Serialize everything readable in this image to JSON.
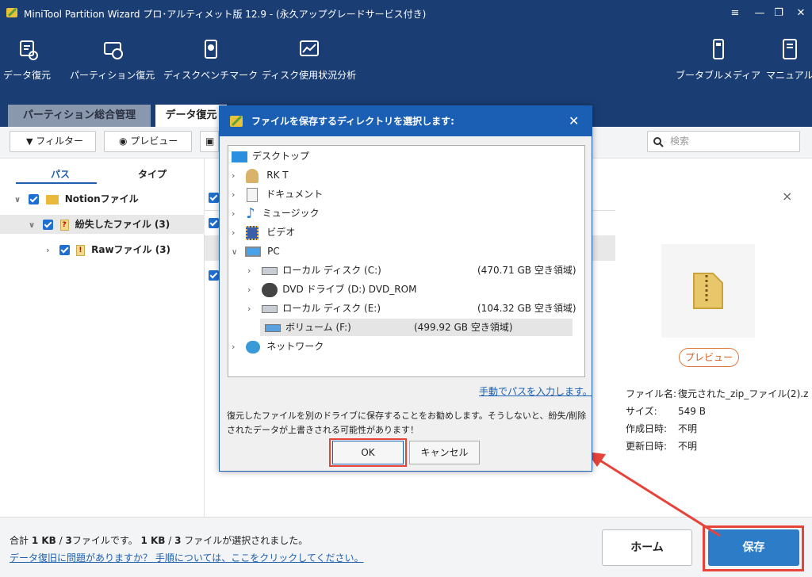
{
  "window": {
    "title": "MiniTool Partition Wizard プロ･アルティメット版 12.9 - (永久アップグレードサービス付き)",
    "controls": [
      "≡",
      "—",
      "❐",
      "✕"
    ]
  },
  "toolbar_main": {
    "items": [
      "データ復元",
      "パーティション復元",
      "ディスクベンチマーク",
      "ディスク使用状況分析"
    ],
    "right_items": [
      "ブータブルメディア",
      "マニュアル"
    ]
  },
  "tabs": [
    "パーティション総合管理",
    "データ復元"
  ],
  "action_bar": {
    "filter": "フィルター",
    "preview": "プレビュー",
    "search_placeholder": "検索"
  },
  "left_pane": {
    "subtabs": [
      "パス",
      "タイプ"
    ],
    "tree": [
      "Notionファイル",
      "紛失したファイル (3)",
      "Rawファイル (3)"
    ]
  },
  "right_pane": {
    "close": "×",
    "preview_button": "プレビュー",
    "info_labels": [
      "ファイル名:",
      "サイズ:",
      "作成日時:",
      "更新日時:"
    ],
    "info_values": [
      "復元された_zip_ファイル(2).z",
      "549 B",
      "不明",
      "不明"
    ]
  },
  "bottom": {
    "summary_prefix": "合計 ",
    "summary_b1": "1 KB",
    "summary_mid": " / ",
    "summary_b2": "3",
    "summary_mid2": "ファイルです。 ",
    "summary_b3": "1 KB",
    "summary_mid3": " / ",
    "summary_b4": "3",
    "summary_end": " ファイルが選択されました。",
    "help_link": "データ復旧に問題がありますか？ 手順については、ここをクリックしてください。",
    "home_button": "ホーム",
    "save_button": "保存"
  },
  "dialog": {
    "title": "ファイルを保存するディレクトリを選択します:",
    "close": "✕",
    "tree": [
      {
        "label": "デスクトップ",
        "size": ""
      },
      {
        "label": "RK T",
        "size": ""
      },
      {
        "label": "ドキュメント",
        "size": ""
      },
      {
        "label": "ミュージック",
        "size": ""
      },
      {
        "label": "ビデオ",
        "size": ""
      },
      {
        "label": "PC",
        "size": ""
      },
      {
        "label": "ローカル ディスク (C:)",
        "size": "(470.71 GB 空き領域)"
      },
      {
        "label": "DVD ドライブ (D:) DVD_ROM",
        "size": ""
      },
      {
        "label": "ローカル ディスク (E:)",
        "size": "(104.32 GB 空き領域)"
      },
      {
        "label": "ボリューム (F:)",
        "size": "(499.92 GB 空き領域)"
      },
      {
        "label": "ネットワーク",
        "size": ""
      }
    ],
    "manual_path_link": "手動でパスを入力します。",
    "warning": "復元したファイルを別のドライブに保存することをお勧めします。そうしないと、紛失/削除されたデータが上書きされる可能性があります！",
    "ok": "OK",
    "cancel": "キャンセル"
  },
  "colors": {
    "header": "#1a3d73",
    "dialog_title": "#1a5fb4",
    "accent": "#1f6fd1",
    "highlight": "#e8433a",
    "save_button": "#2d7cc8"
  }
}
